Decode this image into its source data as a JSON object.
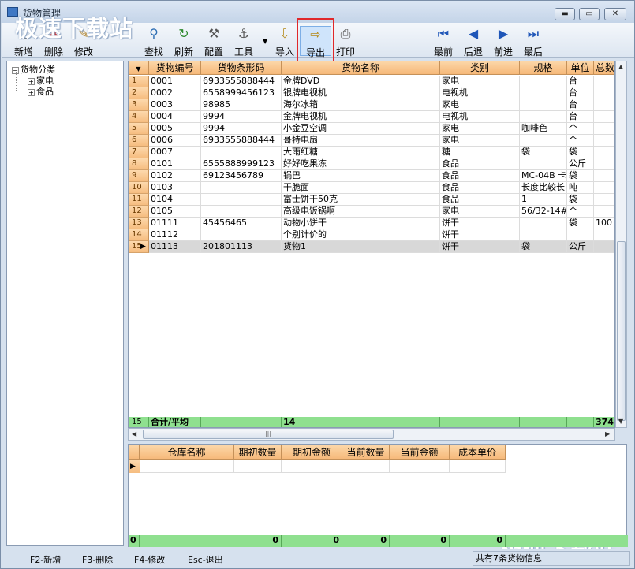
{
  "window": {
    "title": "货物管理",
    "buttons": {
      "minimize": "▬",
      "maximize": "▭",
      "close": "✕"
    }
  },
  "watermark": "极速下载站",
  "toolbar": {
    "items": [
      {
        "name": "add",
        "label": "新增",
        "icon": "new-doc-icon"
      },
      {
        "name": "delete",
        "label": "删除",
        "icon": "delete-icon"
      },
      {
        "name": "edit",
        "label": "修改",
        "icon": "edit-icon"
      },
      {
        "name": "find",
        "label": "查找",
        "icon": "search-icon"
      },
      {
        "name": "refresh",
        "label": "刷新",
        "icon": "refresh-icon"
      },
      {
        "name": "config",
        "label": "配置",
        "icon": "hammer-icon"
      },
      {
        "name": "tools",
        "label": "工具",
        "icon": "paperclip-icon"
      },
      {
        "name": "import",
        "label": "导入",
        "icon": "import-icon"
      },
      {
        "name": "export",
        "label": "导出",
        "icon": "export-icon"
      },
      {
        "name": "print",
        "label": "打印",
        "icon": "printer-icon"
      },
      {
        "name": "first",
        "label": "最前",
        "icon": "first-icon"
      },
      {
        "name": "prev",
        "label": "后退",
        "icon": "prev-icon"
      },
      {
        "name": "next",
        "label": "前进",
        "icon": "next-icon"
      },
      {
        "name": "last",
        "label": "最后",
        "icon": "last-icon"
      }
    ]
  },
  "tree": {
    "root": "货物分类",
    "children": [
      "家电",
      "食品"
    ]
  },
  "goods_grid": {
    "columns": [
      "货物编号",
      "货物条形码",
      "货物名称",
      "类别",
      "规格",
      "单位",
      "总数"
    ],
    "rows": [
      {
        "n": "1",
        "code": "0001",
        "barcode": "6933555888444",
        "name": "金牌DVD",
        "cat": "家电",
        "spec": "",
        "unit": "台",
        "total": ""
      },
      {
        "n": "2",
        "code": "0002",
        "barcode": "6558999456123",
        "name": "银牌电视机",
        "cat": "电视机",
        "spec": "",
        "unit": "台",
        "total": ""
      },
      {
        "n": "3",
        "code": "0003",
        "barcode": "98985",
        "name": "海尔冰箱",
        "cat": "家电",
        "spec": "",
        "unit": "台",
        "total": ""
      },
      {
        "n": "4",
        "code": "0004",
        "barcode": "9994",
        "name": "金牌电视机",
        "cat": "电视机",
        "spec": "",
        "unit": "台",
        "total": ""
      },
      {
        "n": "5",
        "code": "0005",
        "barcode": "9994",
        "name": "小金豆空调",
        "cat": "家电",
        "spec": "咖啡色",
        "unit": "个",
        "total": ""
      },
      {
        "n": "6",
        "code": "0006",
        "barcode": "6933555888444",
        "name": "哥特电扇",
        "cat": "家电",
        "spec": "",
        "unit": "个",
        "total": ""
      },
      {
        "n": "7",
        "code": "0007",
        "barcode": "",
        "name": "大雨红糖",
        "cat": "糖",
        "spec": "袋",
        "unit": "袋",
        "total": ""
      },
      {
        "n": "8",
        "code": "0101",
        "barcode": "6555888999123",
        "name": "好好吃果冻",
        "cat": "食品",
        "spec": "",
        "unit": "公斤",
        "total": ""
      },
      {
        "n": "9",
        "code": "0102",
        "barcode": "69123456789",
        "name": "锅巴",
        "cat": "食品",
        "spec": "MC-04B 卡",
        "unit": "袋",
        "total": ""
      },
      {
        "n": "10",
        "code": "0103",
        "barcode": "",
        "name": "干脆面",
        "cat": "食品",
        "spec": "长度比较长",
        "unit": "吨",
        "total": ""
      },
      {
        "n": "11",
        "code": "0104",
        "barcode": "",
        "name": "富士饼干50克",
        "cat": "食品",
        "spec": "1",
        "unit": "袋",
        "total": ""
      },
      {
        "n": "12",
        "code": "0105",
        "barcode": "",
        "name": "高级电饭锅啊",
        "cat": "家电",
        "spec": "56/32-14#",
        "unit": "个",
        "total": ""
      },
      {
        "n": "13",
        "code": "01111",
        "barcode": "45456465",
        "name": "动物小饼干",
        "cat": "饼干",
        "spec": "",
        "unit": "袋",
        "total": "100"
      },
      {
        "n": "14",
        "code": "01112",
        "barcode": "",
        "name": "个别计价的",
        "cat": "饼干",
        "spec": "",
        "unit": "",
        "total": ""
      },
      {
        "n": "15",
        "code": "01113",
        "barcode": "201801113",
        "name": "货物1",
        "cat": "饼干",
        "spec": "袋",
        "unit": "公斤",
        "total": ""
      }
    ],
    "summary": {
      "n": "15",
      "label": "合计/平均",
      "count": "14",
      "total": "374."
    },
    "hscroll_grip": "|||"
  },
  "stock_grid": {
    "columns": [
      "仓库名称",
      "期初数量",
      "期初金额",
      "当前数量",
      "当前金额",
      "成本单价"
    ],
    "summary": [
      "0",
      "0",
      "0",
      "0",
      "0",
      "0"
    ]
  },
  "statusbar": {
    "hints": [
      "F2-新增",
      "F3-删除",
      "F4-修改",
      "Esc-退出"
    ],
    "info": "共有7条货物信息"
  }
}
